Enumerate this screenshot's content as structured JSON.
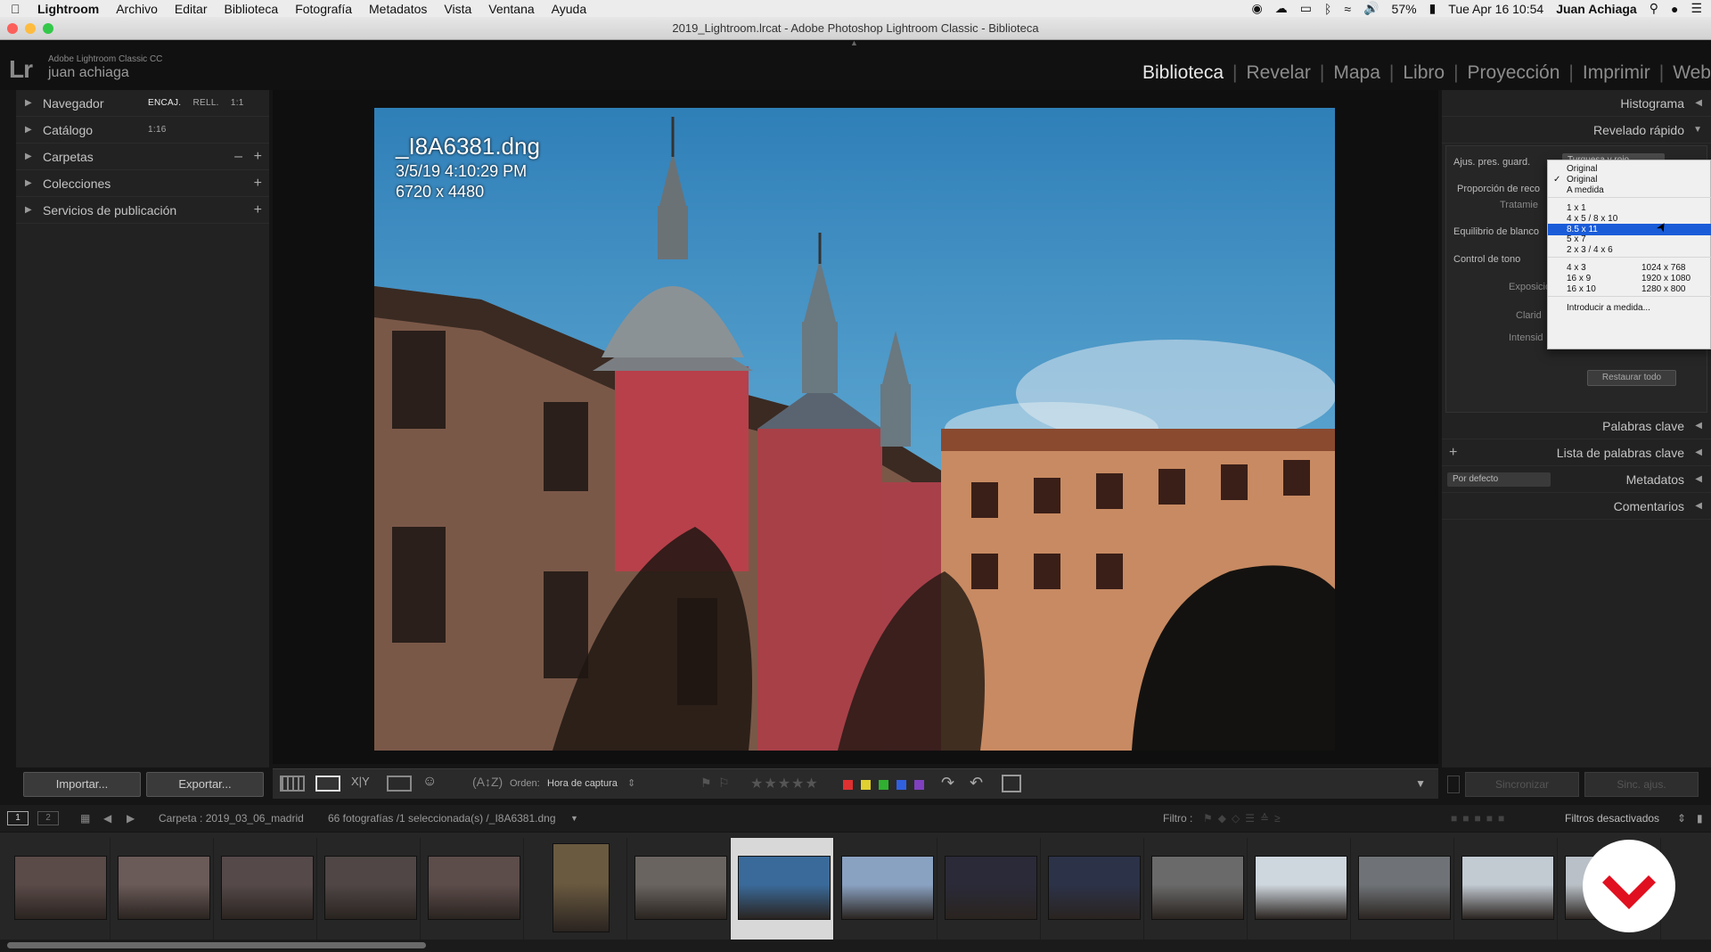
{
  "menubar": {
    "app": "Lightroom",
    "items": [
      "Archivo",
      "Editar",
      "Biblioteca",
      "Fotografía",
      "Metadatos",
      "Vista",
      "Ventana",
      "Ayuda"
    ],
    "battery": "57%",
    "datetime": "Tue Apr 16  10:54",
    "user": "Juan Achiaga"
  },
  "window": {
    "title": "2019_Lightroom.lrcat - Adobe Photoshop Lightroom Classic - Biblioteca"
  },
  "identity": {
    "product": "Adobe Lightroom Classic CC",
    "user": "juan achiaga"
  },
  "modules": [
    "Biblioteca",
    "Revelar",
    "Mapa",
    "Libro",
    "Proyección",
    "Imprimir",
    "Web"
  ],
  "left_panel": {
    "navigator": {
      "label": "Navegador",
      "opts": [
        "ENCAJ.",
        "RELL.",
        "1:1",
        "1:16"
      ]
    },
    "items": [
      "Catálogo",
      "Carpetas",
      "Colecciones",
      "Servicios de publicación"
    ],
    "import": "Importar...",
    "export": "Exportar..."
  },
  "photo_info": {
    "filename": "_I8A6381.dng",
    "date": "3/5/19 4:10:29 PM",
    "dimensions": "6720 x 4480"
  },
  "toolbar": {
    "sort_label": "Orden:",
    "sort_value": "Hora de captura"
  },
  "right_panel": {
    "histogram": "Histograma",
    "quick_develop": "Revelado rápido",
    "qd_rows": {
      "preset": "Ajus. pres. guard.",
      "preset_value": "Turquesa y rojo",
      "crop": "Proporción de reco",
      "treat": "Tratamie",
      "wb": "Equilibrio de blanco",
      "tone": "Control de tono",
      "exposure": "Exposició",
      "clarity": "Clarid",
      "vibrance": "Intensid",
      "reset": "Restaurar todo"
    },
    "keywords": "Palabras clave",
    "keyword_list": "Lista de palabras clave",
    "metadata_preset": "Por defecto",
    "metadata": "Metadatos",
    "comments": "Comentarios",
    "sync": "Sincronizar",
    "sync_settings": "Sinc. ajus."
  },
  "dropdown": {
    "items": [
      {
        "label": "Original"
      },
      {
        "label": "Original",
        "checked": "✓"
      },
      {
        "label": "A medida"
      },
      {
        "label": "1 x 1"
      },
      {
        "label": "4 x 5  /  8 x 10"
      },
      {
        "label": "8.5 x 11",
        "selected": true
      },
      {
        "label": "5 x 7"
      },
      {
        "label": "2 x 3  /  4 x 6"
      },
      {
        "label": "4 x 3",
        "v2": "1024 x 768"
      },
      {
        "label": "16 x 9",
        "v2": "1920 x 1080"
      },
      {
        "label": "16 x 10",
        "v2": "1280 x 800"
      },
      {
        "label": "Introducir a medida..."
      }
    ]
  },
  "filmstrip_bar": {
    "page1": "1",
    "page2": "2",
    "folder": "Carpeta : 2019_03_06_madrid",
    "count": "66 fotografías /1 seleccionada(s) /_I8A6381.dng",
    "filter_label": "Filtro :",
    "filter_value": "Filtros desactivados"
  },
  "thumb_count": 16,
  "colors": {
    "accent_select": "#1a5cd8",
    "panel": "#222222",
    "center_bg": "#0f0f0f",
    "labels": [
      "#e03030",
      "#e0d030",
      "#30b030",
      "#3060e0",
      "#8040c0"
    ],
    "watermark": "#e01020"
  }
}
